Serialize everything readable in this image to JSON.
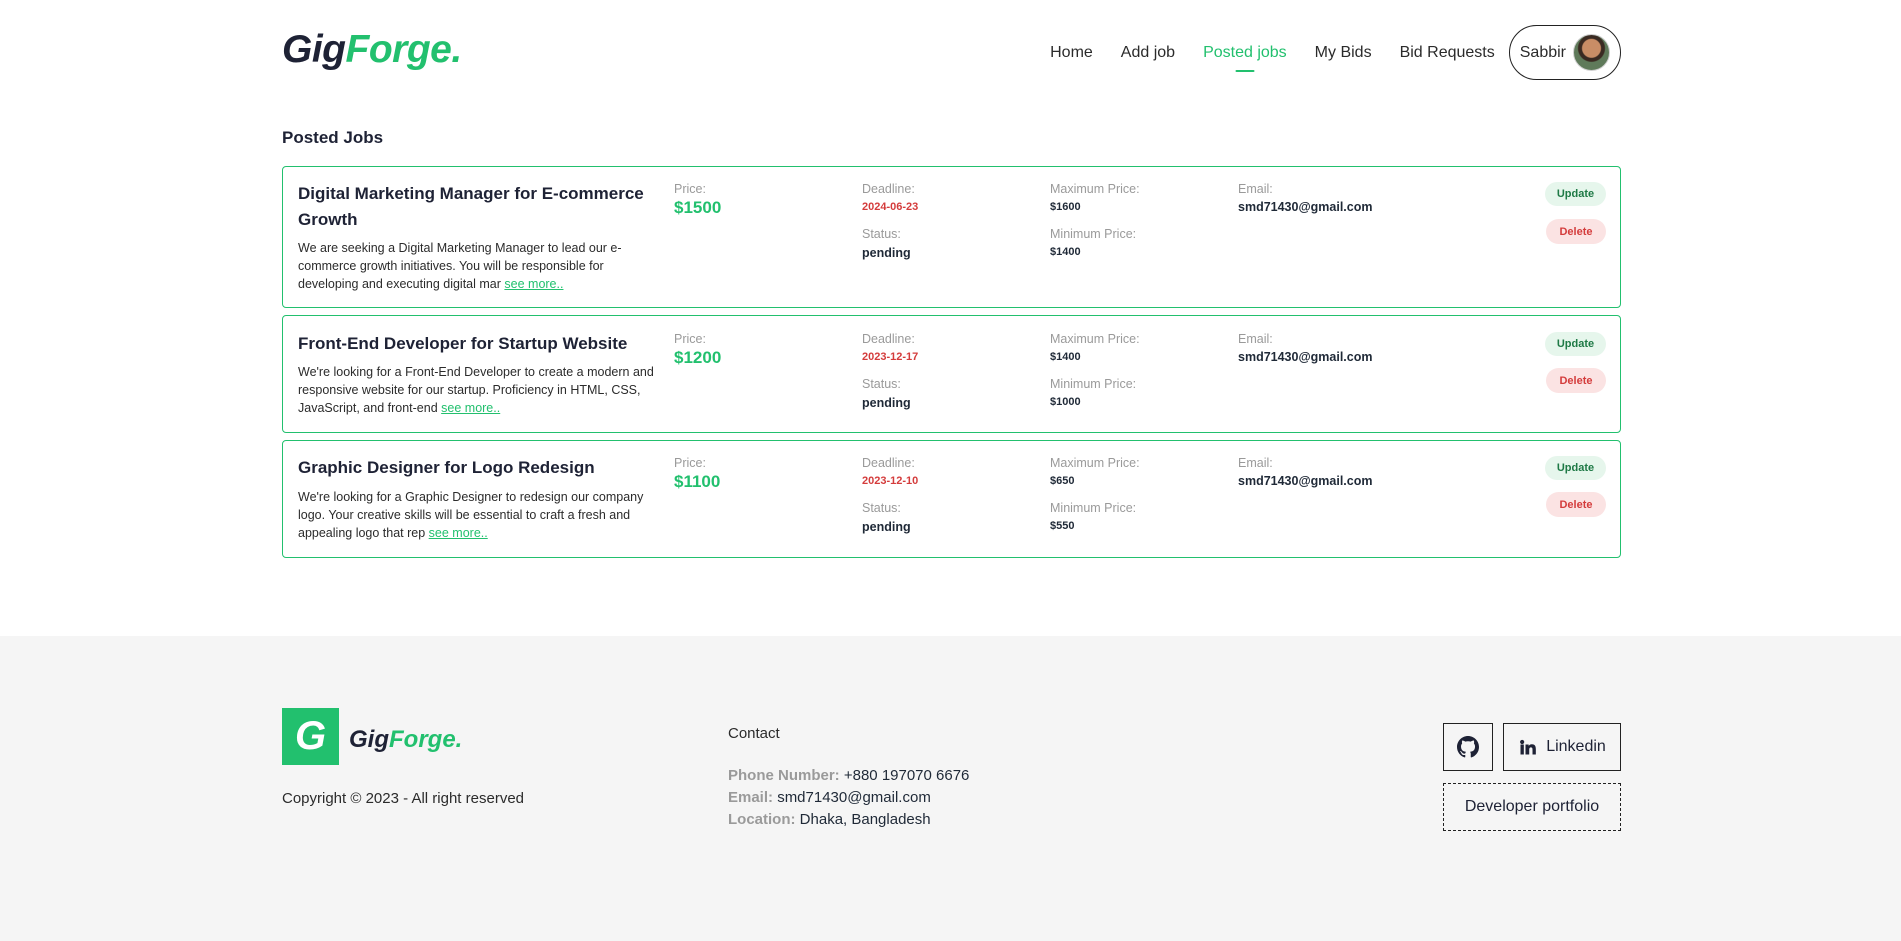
{
  "brand": {
    "logo_main": "Gig",
    "logo_accent": "Forge."
  },
  "nav": {
    "items": [
      "Home",
      "Add job",
      "Posted jobs",
      "My Bids",
      "Bid Requests"
    ],
    "user_name": "Sabbir"
  },
  "page_title": "Posted Jobs",
  "labels": {
    "price": "Price:",
    "deadline": "Deadline:",
    "status": "Status:",
    "max_price": "Maximum Price:",
    "min_price": "Minimum Price:",
    "email": "Email:",
    "see_more": "see more..",
    "update": "Update",
    "delete": "Delete"
  },
  "jobs": [
    {
      "title": "Digital Marketing Manager for E-commerce Growth",
      "description": "We are seeking a Digital Marketing Manager to lead our e-commerce growth initiatives. You will be responsible for developing and executing digital mar",
      "price": "$1500",
      "deadline": "2024-06-23",
      "status": "pending",
      "max_price": "$1600",
      "min_price": "$1400",
      "email": "smd71430@gmail.com"
    },
    {
      "title": "Front-End Developer for Startup Website",
      "description": "We're looking for a Front-End Developer to create a modern and responsive website for our startup. Proficiency in HTML, CSS, JavaScript, and front-end",
      "price": "$1200",
      "deadline": "2023-12-17",
      "status": "pending",
      "max_price": "$1400",
      "min_price": "$1000",
      "email": "smd71430@gmail.com"
    },
    {
      "title": "Graphic Designer for Logo Redesign",
      "description": "We're looking for a Graphic Designer to redesign our company logo. Your creative skills will be essential to craft a fresh and appealing logo that rep",
      "price": "$1100",
      "deadline": "2023-12-10",
      "status": "pending",
      "max_price": "$650",
      "min_price": "$550",
      "email": "smd71430@gmail.com"
    }
  ],
  "footer": {
    "logo_letter": "G",
    "copyright": "Copyright © 2023 - All right reserved",
    "contact_title": "Contact",
    "phone_label": "Phone Number:",
    "phone": "+880 197070 6676",
    "email_label": "Email:",
    "email": "smd71430@gmail.com",
    "location_label": "Location:",
    "location": "Dhaka, Bangladesh",
    "linkedin": "Linkedin",
    "portfolio": "Developer portfolio"
  },
  "colors": {
    "accent": "#22c06e",
    "danger": "#d43c3c",
    "dark": "#1e2235"
  },
  "icons": {
    "github": "github-icon",
    "linkedin": "linkedin-icon"
  }
}
